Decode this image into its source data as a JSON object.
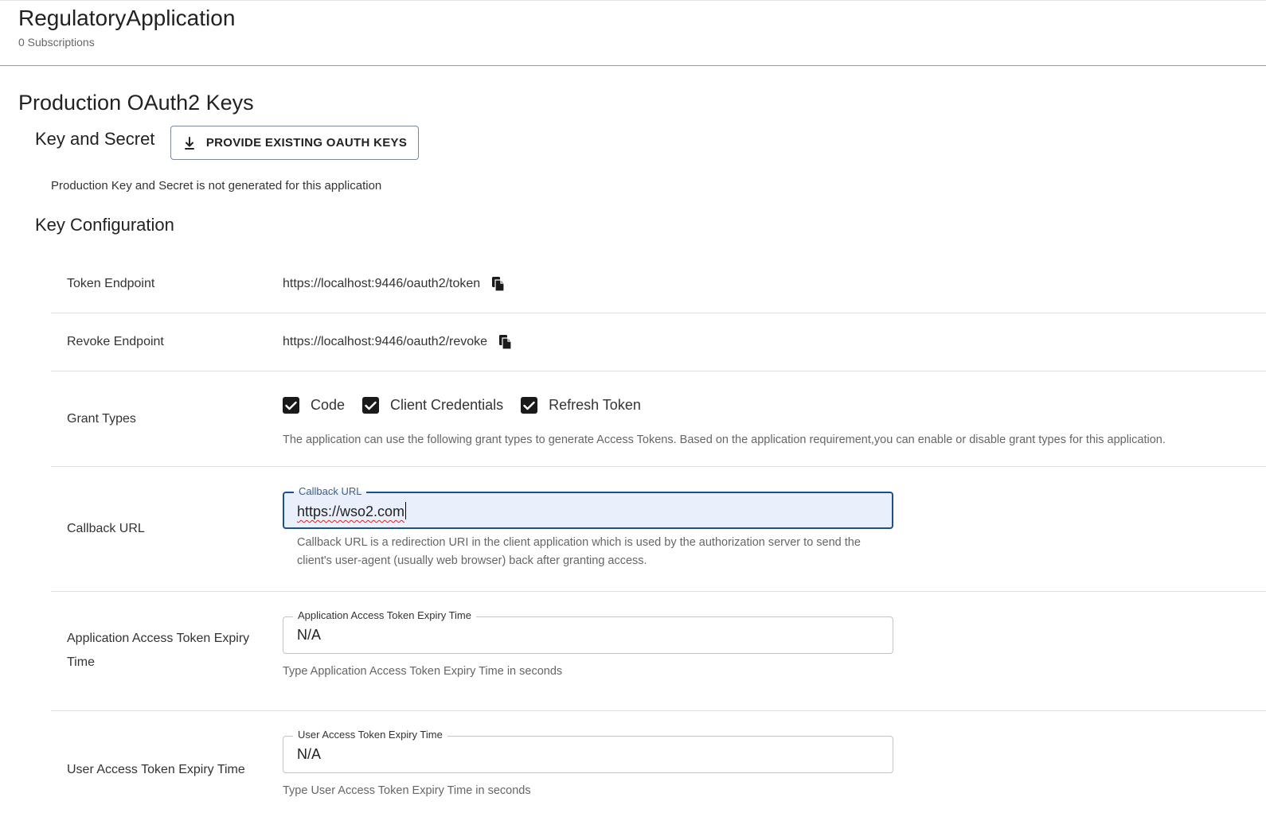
{
  "header": {
    "app_name": "RegulatoryApplication",
    "subscriptions": "0 Subscriptions"
  },
  "production": {
    "section_title": "Production OAuth2 Keys",
    "key_secret_title": "Key and Secret",
    "provide_button_label": "PROVIDE EXISTING OAUTH KEYS",
    "not_generated_note": "Production Key and Secret is not generated for this application"
  },
  "key_config": {
    "title": "Key Configuration",
    "token_endpoint": {
      "label": "Token Endpoint",
      "value": "https://localhost:9446/oauth2/token"
    },
    "revoke_endpoint": {
      "label": "Revoke Endpoint",
      "value": "https://localhost:9446/oauth2/revoke"
    },
    "grant_types": {
      "label": "Grant Types",
      "options": [
        {
          "label": "Code",
          "checked": true
        },
        {
          "label": "Client Credentials",
          "checked": true
        },
        {
          "label": "Refresh Token",
          "checked": true
        }
      ],
      "help": "The application can use the following grant types to generate Access Tokens. Based on the application requirement,you can enable or disable grant types for this application."
    },
    "callback_url": {
      "label": "Callback URL",
      "field_label": "Callback URL",
      "value": "https://wso2.com",
      "help_line1": "Callback URL is a redirection URI in the client application which is used by the authorization server to send the",
      "help_line2": "client's user-agent (usually web browser) back after granting access."
    },
    "app_token_expiry": {
      "label_line1": "Application Access Token Expiry",
      "label_line2": "Time",
      "field_label": "Application Access Token Expiry Time",
      "value": "N/A",
      "help": "Type Application Access Token Expiry Time in seconds"
    },
    "user_token_expiry": {
      "label": "User Access Token Expiry Time",
      "field_label": "User Access Token Expiry Time",
      "value": "N/A",
      "help": "Type User Access Token Expiry Time in seconds"
    }
  },
  "colors": {
    "focus_border": "#1c4f8f",
    "focus_fill": "#e9f0fb",
    "checkbox": "#1a1a1a"
  }
}
